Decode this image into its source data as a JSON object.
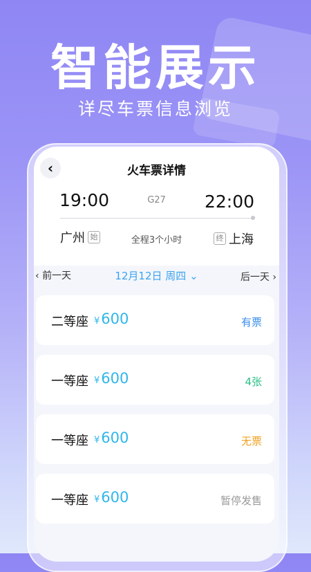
{
  "hero": {
    "title": "智能展示",
    "subtitle": "详尽车票信息浏览"
  },
  "header": {
    "back_icon": "chevron-left-icon",
    "title": "火车票详情"
  },
  "trip": {
    "departure_time": "19:00",
    "arrival_time": "22:00",
    "train_number": "G27",
    "departure_station": "广州",
    "departure_tag": "始",
    "arrival_station": "上海",
    "arrival_tag": "终",
    "duration": "全程3个小时"
  },
  "date_bar": {
    "prev_label": "前一天",
    "next_label": "后一天",
    "selected_date": "12月12日  周四",
    "dropdown_icon": "chevron-down-icon"
  },
  "seats": [
    {
      "name": "二等座",
      "currency": "¥",
      "price": "600",
      "status": "有票",
      "status_color": "#3a8ee8"
    },
    {
      "name": "一等座",
      "currency": "¥",
      "price": "600",
      "status": "4张",
      "status_color": "#2bbf86"
    },
    {
      "name": "一等座",
      "currency": "¥",
      "price": "600",
      "status": "无票",
      "status_color": "#f0a020"
    },
    {
      "name": "一等座",
      "currency": "¥",
      "price": "600",
      "status": "暂停发售",
      "status_color": "#9a9a9a"
    }
  ],
  "colors": {
    "accent": "#2fb6ea",
    "date_accent": "#3aa3f0",
    "background_top": "#8f86f4"
  }
}
